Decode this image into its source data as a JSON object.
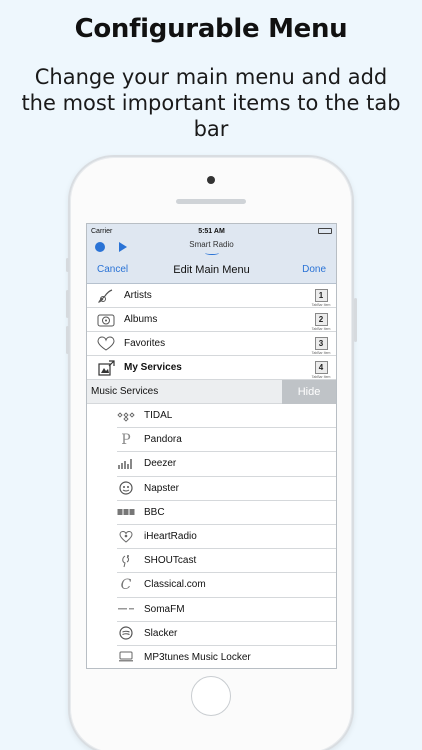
{
  "promo": {
    "headline": "Configurable Menu",
    "subline": "Change your main menu and add the most important items to the tab bar"
  },
  "status_bar": {
    "carrier": "Carrier",
    "time": "5:51 AM"
  },
  "player": {
    "title": "Smart Radio"
  },
  "nav": {
    "cancel_label": "Cancel",
    "title": "Edit Main Menu",
    "done_label": "Done"
  },
  "menu_items": [
    {
      "label": "Artists",
      "icon": "guitar-icon",
      "tab_number": "1",
      "tab_caption": "TabBar Item"
    },
    {
      "label": "Albums",
      "icon": "album-icon",
      "tab_number": "2",
      "tab_caption": "TabBar Item"
    },
    {
      "label": "Favorites",
      "icon": "heart-icon",
      "tab_number": "3",
      "tab_caption": "TabBar Item"
    },
    {
      "label": "My Services",
      "icon": "services-icon",
      "tab_number": "4",
      "tab_caption": "TabBar Item"
    }
  ],
  "music_services": {
    "label": "Music Services",
    "hide_label": "Hide",
    "items": [
      {
        "label": "TIDAL",
        "icon": "tidal-icon"
      },
      {
        "label": "Pandora",
        "icon": "pandora-icon"
      },
      {
        "label": "Deezer",
        "icon": "deezer-icon"
      },
      {
        "label": "Napster",
        "icon": "napster-icon"
      },
      {
        "label": "BBC",
        "icon": "bbc-icon"
      },
      {
        "label": "iHeartRadio",
        "icon": "iheartradio-icon"
      },
      {
        "label": "SHOUTcast",
        "icon": "shoutcast-icon"
      },
      {
        "label": "Classical.com",
        "icon": "classical-icon"
      },
      {
        "label": "SomaFM",
        "icon": "somafm-icon"
      },
      {
        "label": "Slacker",
        "icon": "slacker-icon"
      },
      {
        "label": "MP3tunes Music Locker",
        "icon": "mp3tunes-icon"
      }
    ]
  },
  "colors": {
    "accent": "#2a73d6",
    "bar_background": "#dfe7f1",
    "hide_button": "#bfc3c7",
    "page_background": "#eef7fd"
  }
}
